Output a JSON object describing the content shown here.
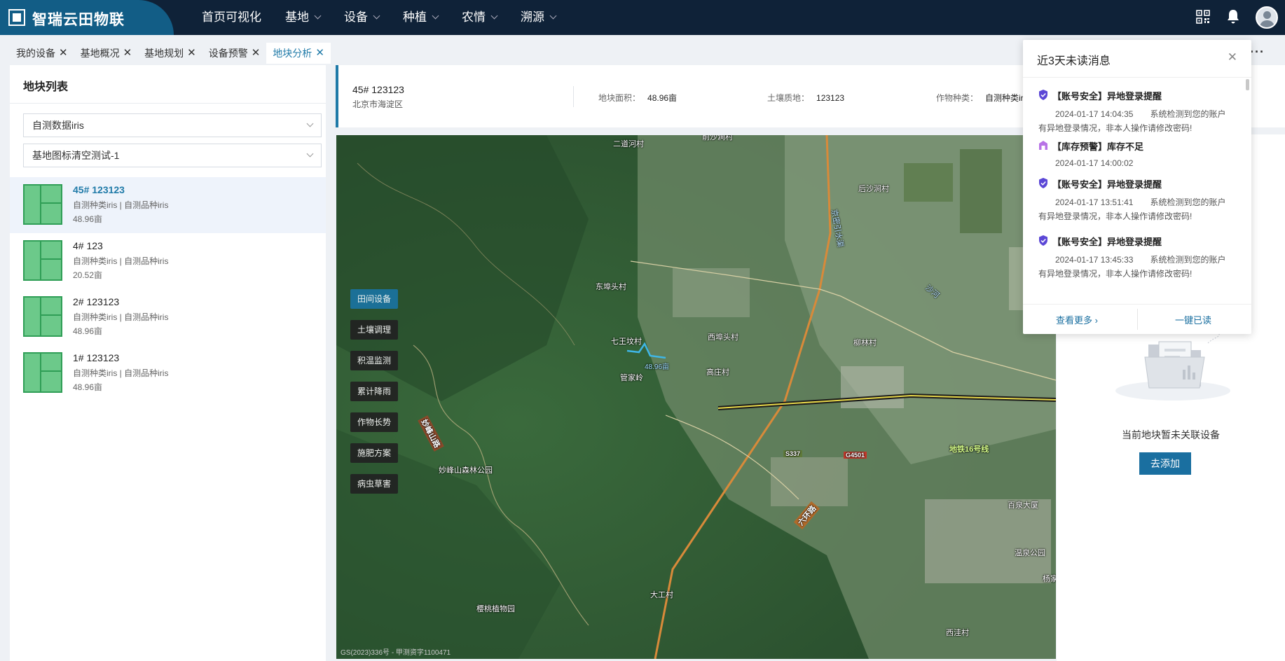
{
  "app": {
    "title": "智瑞云田物联"
  },
  "nav": {
    "items": [
      {
        "label": "首页可视化",
        "dropdown": false
      },
      {
        "label": "基地",
        "dropdown": true
      },
      {
        "label": "设备",
        "dropdown": true
      },
      {
        "label": "种植",
        "dropdown": true
      },
      {
        "label": "农情",
        "dropdown": true
      },
      {
        "label": "溯源",
        "dropdown": true
      }
    ]
  },
  "tabs": [
    {
      "label": "我的设备",
      "active": false
    },
    {
      "label": "基地概况",
      "active": false
    },
    {
      "label": "基地规划",
      "active": false
    },
    {
      "label": "设备预警",
      "active": false
    },
    {
      "label": "地块分析",
      "active": true
    }
  ],
  "left": {
    "title": "地块列表",
    "select1": "自测数据iris",
    "select2": "基地图标清空测试-1",
    "plots": [
      {
        "name": "45# 123123",
        "meta": "自测种类iris | 自测品种iris",
        "area": "48.96亩",
        "selected": true
      },
      {
        "name": "4# 123",
        "meta": "自测种类iris | 自测品种iris",
        "area": "20.52亩",
        "selected": false
      },
      {
        "name": "2# 123123",
        "meta": "自测种类iris | 自测品种iris",
        "area": "48.96亩",
        "selected": false
      },
      {
        "name": "1# 123123",
        "meta": "自测种类iris | 自测品种iris",
        "area": "48.96亩",
        "selected": false
      }
    ]
  },
  "info": {
    "name": "45# 123123",
    "address": "北京市海淀区",
    "area_label": "地块面积：",
    "area_value": "48.96亩",
    "soil_label": "土壤质地：",
    "soil_value": "123123",
    "crop_label": "作物种类：",
    "crop_value": "自测种类iris"
  },
  "map": {
    "buttons": [
      "田间设备",
      "土壤调理",
      "积温监测",
      "累计降雨",
      "作物长势",
      "施肥方案",
      "病虫草害"
    ],
    "active_button": "田间设备",
    "labels": {
      "l1": "二道河村",
      "l2": "后沙涧村",
      "l3": "东埠头村",
      "l4": "七王坟村",
      "l5": "西埠头村",
      "l6": "柳林村",
      "l7": "管家岭",
      "l8": "高庄村",
      "l9": "妙峰山路",
      "l10": "妙峰山森林公园",
      "l11": "S337",
      "l12": "G4501",
      "l13": "地铁16号线",
      "l14": "百泉大厦",
      "l15": "六环路",
      "l16": "大工村",
      "l17": "樱桃植物园",
      "l18": "西洼村",
      "l19": "温泉公园",
      "l20": "48.96亩",
      "l21": "京密引水渠",
      "l22": "沙河",
      "l23": "杨家",
      "l24": "前沙涧村"
    },
    "copyright": "GS(2023)336号 - 甲测资字1100471"
  },
  "right": {
    "empty_text": "当前地块暂未关联设备",
    "add_button": "去添加"
  },
  "notifications": {
    "title": "近3天未读消息",
    "items": [
      {
        "type": "security",
        "title": "【账号安全】异地登录提醒",
        "time": "2024-01-17 14:04:35",
        "snippet": "系统检测到您的账户",
        "body": "有异地登录情况，非本人操作请修改密码!"
      },
      {
        "type": "inventory",
        "title": "【库存预警】库存不足",
        "time": "2024-01-17 14:00:02",
        "snippet": "",
        "body": ""
      },
      {
        "type": "security",
        "title": "【账号安全】异地登录提醒",
        "time": "2024-01-17 13:51:41",
        "snippet": "系统检测到您的账户",
        "body": "有异地登录情况，非本人操作请修改密码!"
      },
      {
        "type": "security",
        "title": "【账号安全】异地登录提醒",
        "time": "2024-01-17 13:45:33",
        "snippet": "系统检测到您的账户",
        "body": "有异地登录情况，非本人操作请修改密码!"
      }
    ],
    "more_label": "查看更多",
    "read_all_label": "一键已读"
  },
  "colors": {
    "nav_bg": "#0f2238",
    "brand": "#125d86",
    "accent": "#1a6fa0",
    "plot_fill": "#6cc98a"
  }
}
